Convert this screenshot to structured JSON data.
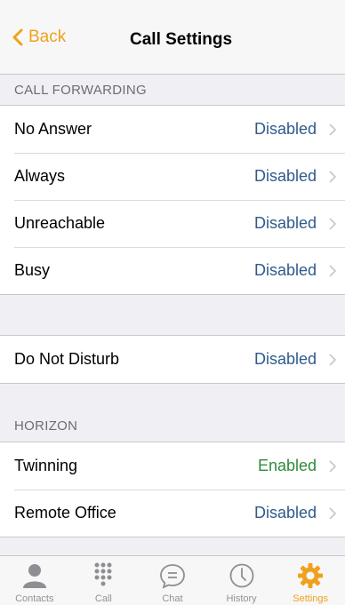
{
  "nav": {
    "back_label": "Back",
    "title": "Call Settings"
  },
  "sections": {
    "call_forwarding": {
      "header": "CALL FORWARDING",
      "rows": [
        {
          "label": "No Answer",
          "value": "Disabled"
        },
        {
          "label": "Always",
          "value": "Disabled"
        },
        {
          "label": "Unreachable",
          "value": "Disabled"
        },
        {
          "label": "Busy",
          "value": "Disabled"
        }
      ]
    },
    "dnd": {
      "rows": [
        {
          "label": "Do Not Disturb",
          "value": "Disabled"
        }
      ]
    },
    "horizon": {
      "header": "HORIZON",
      "rows": [
        {
          "label": "Twinning",
          "value": "Enabled"
        },
        {
          "label": "Remote Office",
          "value": "Disabled"
        }
      ]
    }
  },
  "tabs": [
    {
      "label": "Contacts",
      "icon": "contacts-icon"
    },
    {
      "label": "Call",
      "icon": "keypad-icon"
    },
    {
      "label": "Chat",
      "icon": "chat-icon"
    },
    {
      "label": "History",
      "icon": "clock-icon"
    },
    {
      "label": "Settings",
      "icon": "gear-icon",
      "active": true
    }
  ],
  "colors": {
    "accent": "#f0a11c",
    "value_disabled": "#2f5a8c",
    "value_enabled": "#2e8b3a"
  }
}
